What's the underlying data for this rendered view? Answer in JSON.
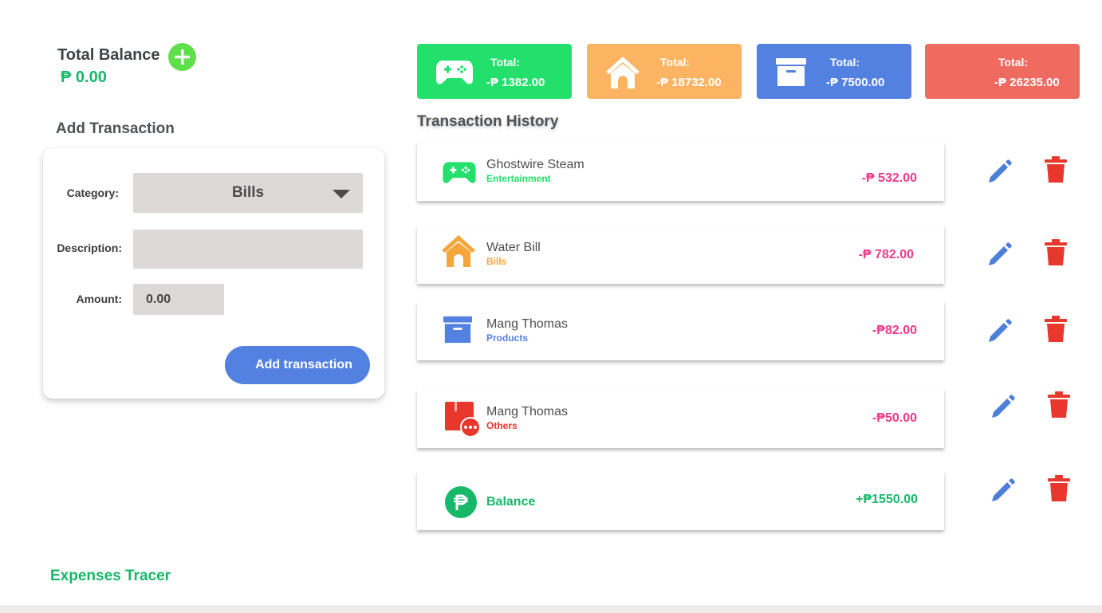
{
  "balance": {
    "label": "Total Balance",
    "value": "₱ 0.00"
  },
  "form": {
    "title": "Add Transaction",
    "category_label": "Category:",
    "category_value": "Bills",
    "description_label": "Description:",
    "description_value": "",
    "amount_label": "Amount:",
    "amount_value": "0.00",
    "submit_label": "Add transaction"
  },
  "summary": [
    {
      "category": "Entertainment",
      "label": "Total:",
      "value": "-₱ 1382.00",
      "color": "#22e06b",
      "icon": "gamepad-icon"
    },
    {
      "category": "Bills",
      "label": "Total:",
      "value": "-₱ 18732.00",
      "color": "#fcb462",
      "icon": "house-icon"
    },
    {
      "category": "Products",
      "label": "Total:",
      "value": "-₱ 7500.00",
      "color": "#5381e2",
      "icon": "archive-box-icon"
    },
    {
      "category": "Others",
      "label": "Total:",
      "value": "-₱ 26235.00",
      "color": "#ef6b60",
      "icon": ""
    }
  ],
  "history": {
    "title": "Transaction History",
    "items": [
      {
        "name": "Ghostwire Steam",
        "category": "Entertainment",
        "category_color": "#22e06b",
        "amount": "-₱ 532.00",
        "icon": "gamepad-icon"
      },
      {
        "name": "Water Bill",
        "category": "Bills",
        "category_color": "#f5a53a",
        "amount": "-₱ 782.00",
        "icon": "house-icon"
      },
      {
        "name": "Mang Thomas",
        "category": "Products",
        "category_color": "#5381e2",
        "amount": "-₱82.00",
        "icon": "archive-box-icon"
      },
      {
        "name": "Mang Thomas",
        "category": "Others",
        "category_color": "#e8372c",
        "amount": "-₱50.00",
        "icon": "box-more-icon"
      },
      {
        "name": "Balance",
        "category": "",
        "category_color": "#17b86a",
        "amount": "+₱1550.00",
        "icon": "peso-coin-icon"
      }
    ]
  },
  "actions": {
    "edit_icon": "pencil-icon",
    "delete_icon": "trash-icon",
    "edit_color": "#4d7fd8",
    "delete_color": "#e8372c"
  },
  "footer": {
    "app_name": "Expenses Tracer"
  }
}
